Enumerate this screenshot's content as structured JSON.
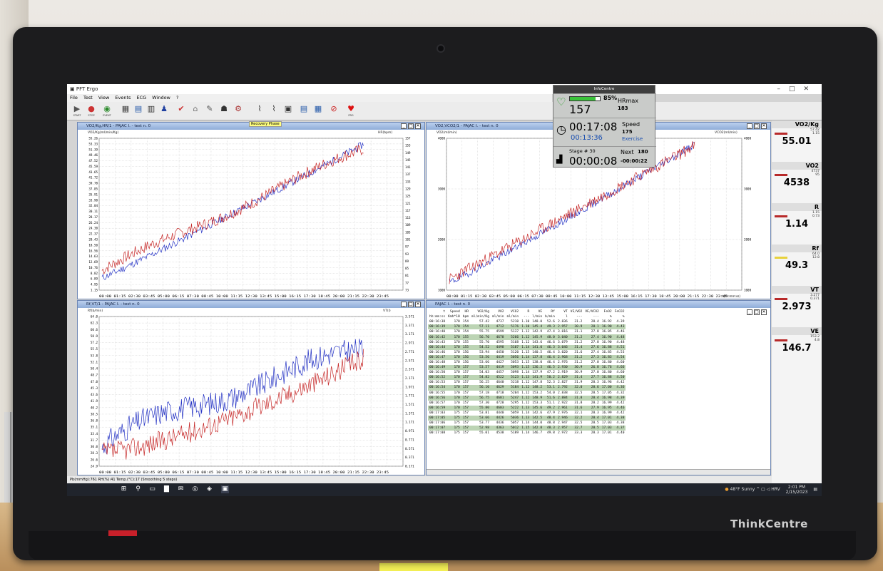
{
  "window": {
    "title": "PFT Ergo",
    "menu": [
      "File",
      "Test",
      "View",
      "Events",
      "ECG",
      "Window",
      "?"
    ],
    "recovery_label": "Recovery Phase"
  },
  "toolbar": {
    "start": "START",
    "stop": "STOP",
    "event": "EVENT",
    "prg": "PRG"
  },
  "panels": {
    "p1": {
      "title": "VO2/Kg,HR/1 - PAJAC I. - test n. 0",
      "left_axis": "VO2/Kg(ml/min/Kg)",
      "right_axis": "HR(bpm)",
      "yl": [
        "55.26",
        "53.33",
        "51.39",
        "49.46",
        "47.52",
        "45.59",
        "43.65",
        "41.72",
        "39.78",
        "37.85",
        "35.91",
        "33.98",
        "32.04",
        "30.11",
        "28.17",
        "26.24",
        "24.30",
        "22.37",
        "20.43",
        "18.50",
        "16.56",
        "14.63",
        "12.69",
        "10.76",
        "8.82",
        "6.89",
        "4.95",
        "1.15"
      ],
      "yr": [
        "157",
        "153",
        "149",
        "145",
        "141",
        "137",
        "133",
        "129",
        "125",
        "121",
        "117",
        "113",
        "109",
        "105",
        "101",
        "97",
        "93",
        "89",
        "85",
        "81",
        "77",
        "73"
      ],
      "x": "00:00 01:15 02:30 03:45 05:00 06:15 07:30 08:45 10:00 11:15 12:30 13:45 15:00 16:15 17:30 18:45 20:00 21:15 22:30 23:45"
    },
    "p2": {
      "title": "VO2,VCO2/1 - PAJAC I. - test n. 0",
      "left_axis": "VO2(ml/min)",
      "right_axis": "VCO2(ml/min)",
      "yl": [
        "4000",
        "3000",
        "2000",
        "1000"
      ],
      "yr": [
        "4000",
        "3000",
        "2000",
        "1000"
      ],
      "x": "00:00 01:15 02:30 03:45 05:00 06:15 07:30 08:45 10:00 11:15 12:30 13:45 15:00 16:15 17:30 18:45 20:00 21:15 22:30 23:45",
      "xunit": "t(hh:mm:ss)"
    },
    "p3": {
      "title": "Rf,VT/1 - PAJAC I. - test n. 0",
      "left_axis": "Rf(b/min)",
      "right_axis": "VT(l)",
      "yl": [
        "64.0",
        "62.3",
        "60.6",
        "58.9",
        "57.2",
        "55.5",
        "53.8",
        "52.1",
        "50.4",
        "48.7",
        "47.0",
        "45.3",
        "43.6",
        "41.9",
        "40.2",
        "38.5",
        "36.8",
        "35.1",
        "33.4",
        "31.7",
        "30.0",
        "28.3",
        "26.6",
        "24.9"
      ],
      "yr": [
        "3.571",
        "3.371",
        "3.171",
        "2.971",
        "2.771",
        "2.571",
        "2.371",
        "2.171",
        "1.971",
        "1.771",
        "1.571",
        "1.371",
        "1.171",
        "0.971",
        "0.771",
        "0.571",
        "0.371",
        "0.171"
      ],
      "x": "00:00 01:15 02:30 03:45 05:00 06:15 07:30 08:45 10:00 11:15 12:30 13:45 15:00 16:15 17:30 18:45 20:00 21:15 22:30 23:45"
    },
    "p4": {
      "title": "PAJAC I. - test n. 0"
    }
  },
  "table": {
    "headers": [
      "t",
      "Speed",
      "HR",
      "VO2/Kg",
      "VO2",
      "VCO2",
      "R",
      "VE",
      "Rf",
      "VT",
      "VE/VO2",
      "VE/VCO2",
      "FeO2",
      "FeCO2"
    ],
    "units": [
      "hh:mm:ss",
      "Kmh*10",
      "bpm",
      "ml/min/Kg",
      "ml/min",
      "ml/min",
      "---",
      "l/min",
      "b/min",
      "l",
      "---",
      "---",
      "%",
      "%"
    ],
    "rows": [
      [
        "00:16:38",
        "170",
        "154",
        "57.42",
        "4737",
        "5210",
        "1.10",
        "148.0",
        "52.6",
        "2.836",
        "31.2",
        "28.4",
        "16.92",
        "4.39"
      ],
      [
        "00:16:39",
        "170",
        "154",
        "57.11",
        "4712",
        "5176",
        "1.10",
        "145.4",
        "49.3",
        "2.957",
        "30.9",
        "28.1",
        "16.90",
        "4.43"
      ],
      [
        "00:16:40",
        "170",
        "154",
        "55.75",
        "4599",
        "5137",
        "1.12",
        "142.9",
        "47.4",
        "3.016",
        "31.1",
        "27.8",
        "16.85",
        "4.46"
      ],
      [
        "00:16:42",
        "170",
        "155",
        "56.70",
        "4678",
        "5266",
        "1.12",
        "145.9",
        "48.0",
        "3.040",
        "31.2",
        "27.4",
        "16.90",
        "4.48"
      ],
      [
        "00:16:43",
        "170",
        "155",
        "55.70",
        "4595",
        "5168",
        "1.12",
        "143.6",
        "46.6",
        "3.079",
        "31.2",
        "27.8",
        "16.90",
        "4.48"
      ],
      [
        "00:16:44",
        "170",
        "155",
        "54.52",
        "4498",
        "5107",
        "1.14",
        "141.0",
        "46.3",
        "3.046",
        "31.4",
        "27.6",
        "16.88",
        "4.51"
      ],
      [
        "00:16:46",
        "170",
        "156",
        "53.94",
        "4450",
        "5120",
        "1.15",
        "140.5",
        "46.4",
        "3.020",
        "31.6",
        "27.4",
        "16.85",
        "4.53"
      ],
      [
        "00:16:47",
        "170",
        "156",
        "53.56",
        "4419",
        "5056",
        "1.14",
        "137.8",
        "46.4",
        "2.968",
        "31.2",
        "27.3",
        "16.83",
        "4.54"
      ],
      [
        "00:16:48",
        "170",
        "156",
        "53.66",
        "4427",
        "5053",
        "1.15",
        "138.0",
        "46.4",
        "2.976",
        "31.2",
        "27.0",
        "16.80",
        "4.60"
      ],
      [
        "00:16:49",
        "170",
        "157",
        "53.57",
        "4419",
        "5093",
        "1.15",
        "136.3",
        "46.5",
        "2.930",
        "30.9",
        "26.8",
        "16.76",
        "4.66"
      ],
      [
        "00:16:50",
        "170",
        "157",
        "54.03",
        "4457",
        "5098",
        "1.14",
        "137.9",
        "47.2",
        "2.919",
        "30.9",
        "27.0",
        "16.80",
        "4.60"
      ],
      [
        "00:16:52",
        "170",
        "157",
        "54.82",
        "4522",
        "5123",
        "1.13",
        "141.9",
        "50.2",
        "2.829",
        "31.4",
        "27.7",
        "16.88",
        "4.50"
      ],
      [
        "00:16:53",
        "170",
        "157",
        "56.25",
        "4640",
        "5218",
        "1.12",
        "147.8",
        "52.3",
        "2.827",
        "31.9",
        "28.3",
        "16.96",
        "4.42"
      ],
      [
        "00:16:54",
        "170",
        "157",
        "56.10",
        "4629",
        "5184",
        "1.12",
        "148.2",
        "53.1",
        "2.792",
        "32.0",
        "28.6",
        "17.00",
        "4.36"
      ],
      [
        "00:16:55",
        "170",
        "157",
        "57.18",
        "4718",
        "5204",
        "1.12",
        "153.2",
        "54.0",
        "2.838",
        "32.5",
        "28.5",
        "17.05",
        "4.32"
      ],
      [
        "00:16:56",
        "170",
        "157",
        "56.75",
        "4681",
        "5247",
        "1.12",
        "148.9",
        "51.6",
        "2.884",
        "31.8",
        "28.4",
        "16.98",
        "4.39"
      ],
      [
        "00:16:57",
        "170",
        "157",
        "57.30",
        "4728",
        "5295",
        "1.12",
        "153.3",
        "51.1",
        "2.922",
        "31.8",
        "28.2",
        "16.99",
        "4.42"
      ],
      [
        "00:16:59",
        "170",
        "157",
        "55.80",
        "4603",
        "5222",
        "1.13",
        "145.6",
        "49.2",
        "2.961",
        "31.6",
        "27.9",
        "16.95",
        "4.46"
      ],
      [
        "00:17:03",
        "175",
        "157",
        "53.81",
        "4440",
        "5059",
        "1.14",
        "142.6",
        "47.9",
        "2.976",
        "32.1",
        "28.3",
        "16.99",
        "4.42"
      ],
      [
        "00:17:05",
        "175",
        "157",
        "53.66",
        "4426",
        "5036",
        "1.13",
        "142.5",
        "48.4",
        "2.946",
        "32.2",
        "28.4",
        "17.01",
        "4.38"
      ],
      [
        "00:17:06",
        "175",
        "157",
        "53.77",
        "4436",
        "5057",
        "1.14",
        "144.0",
        "48.8",
        "2.947",
        "32.5",
        "28.5",
        "17.03",
        "4.38"
      ],
      [
        "00:17:07",
        "175",
        "157",
        "52.98",
        "4363",
        "5012",
        "1.15",
        "142.8",
        "48.3",
        "2.957",
        "32.7",
        "28.5",
        "17.03",
        "4.37"
      ],
      [
        "00:17:08",
        "175",
        "157",
        "55.01",
        "4538",
        "5189",
        "1.14",
        "146.7",
        "49.8",
        "2.972",
        "33.3",
        "28.3",
        "17.01",
        "4.40"
      ]
    ]
  },
  "infocentre": {
    "title": "InfoCentre",
    "progress": "85%",
    "progress_value": 0.85,
    "hr": "157",
    "hrmax_label": "HRmax",
    "hrmax": "183",
    "time": "00:17:08",
    "subtime": "00:13:36",
    "speed_label": "Speed",
    "speed": "175",
    "phase": "Exercise",
    "stage": "Stage # 30",
    "stage_time": "00:00:08",
    "next_label": "Next",
    "next": "180",
    "next_time": "-00:00:22"
  },
  "stats": [
    {
      "label": "VO2/Kg",
      "mini": [
        "57.42",
        "1.15"
      ],
      "value": "55.01"
    },
    {
      "label": "VO2",
      "mini": [
        "4737",
        "95"
      ],
      "value": "4538"
    },
    {
      "label": "R",
      "mini": [
        "1.15",
        "0.73"
      ],
      "value": "1.14"
    },
    {
      "label": "Rf",
      "mini": [
        "64.0",
        "12.8"
      ],
      "value": "49.3"
    },
    {
      "label": "VT",
      "mini": [
        "3.277",
        "0.371"
      ],
      "value": "2.973"
    },
    {
      "label": "VE",
      "mini": [
        "153.2",
        "4.8"
      ],
      "value": "146.7"
    }
  ],
  "status": "Pb(mmHg):761 RH(%):41 Temp.(°C):17 (Smoothing 5 steps)",
  "taskbar": {
    "weather": "48°F Sunny",
    "lang": "HRV",
    "time": "2:01 PM",
    "date": "2/15/2023"
  },
  "brand": "ThinkCentre",
  "colors": {
    "vo2": "#c62828",
    "hr": "#2432c4",
    "grid": "#bdbdbd",
    "table_highlight": "#bcd4b4"
  }
}
